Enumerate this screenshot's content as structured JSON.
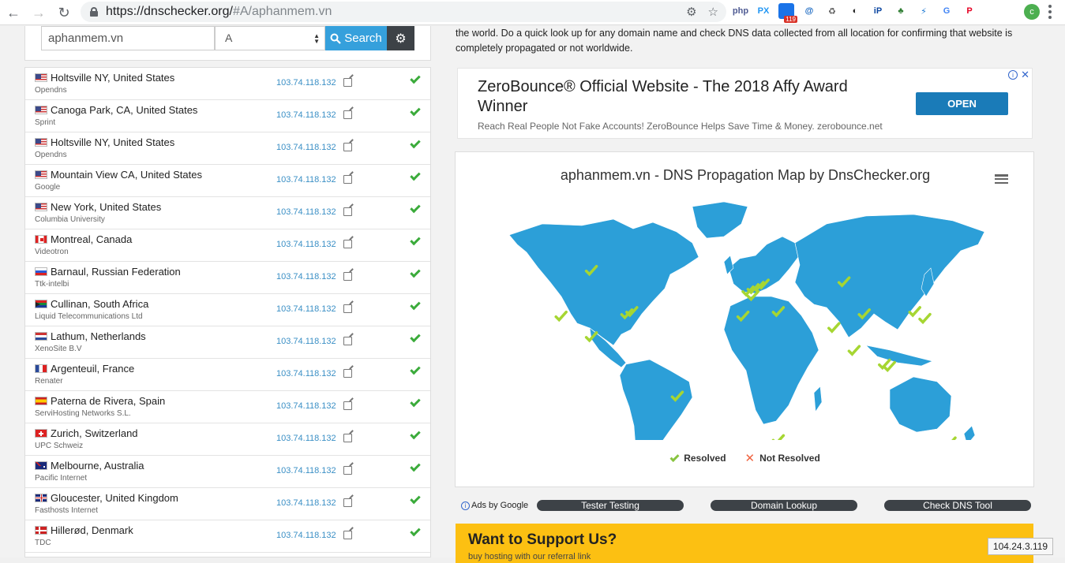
{
  "browser": {
    "url_host": "https://dnschecker.org/",
    "url_path": "#A/aphanmem.vn",
    "extensions": [
      {
        "label": "php",
        "color": "#4f5b93"
      },
      {
        "label": "PX",
        "color": "#2196f3"
      },
      {
        "label": "",
        "color": "#1a73e8",
        "badge": "119"
      },
      {
        "label": "@",
        "color": "#1565c0"
      },
      {
        "label": "♻",
        "color": "#555555"
      },
      {
        "label": "◐",
        "color": "#222222"
      },
      {
        "label": "iP",
        "color": "#0d47a1"
      },
      {
        "label": "♣",
        "color": "#2e7d32"
      },
      {
        "label": "⚡",
        "color": "#1976d2"
      },
      {
        "label": "G",
        "color": "#4285f4"
      },
      {
        "label": "P",
        "color": "#e60023"
      }
    ],
    "profile_initial": "c"
  },
  "search": {
    "domain": "aphanmem.vn",
    "record_type": "A",
    "button_label": "Search"
  },
  "results": [
    {
      "flag": "us",
      "location": "Holtsville NY, United States",
      "isp": "Opendns",
      "ip": "103.74.118.132"
    },
    {
      "flag": "us",
      "location": "Canoga Park, CA, United States",
      "isp": "Sprint",
      "ip": "103.74.118.132"
    },
    {
      "flag": "us",
      "location": "Holtsville NY, United States",
      "isp": "Opendns",
      "ip": "103.74.118.132"
    },
    {
      "flag": "us",
      "location": "Mountain View CA, United States",
      "isp": "Google",
      "ip": "103.74.118.132"
    },
    {
      "flag": "us",
      "location": "New York, United States",
      "isp": "Columbia University",
      "ip": "103.74.118.132"
    },
    {
      "flag": "ca",
      "location": "Montreal, Canada",
      "isp": "Videotron",
      "ip": "103.74.118.132"
    },
    {
      "flag": "ru",
      "location": "Barnaul, Russian Federation",
      "isp": "Ttk-intelbi",
      "ip": "103.74.118.132"
    },
    {
      "flag": "za",
      "location": "Cullinan, South Africa",
      "isp": "Liquid Telecommunications Ltd",
      "ip": "103.74.118.132"
    },
    {
      "flag": "nl",
      "location": "Lathum, Netherlands",
      "isp": "XenoSite B.V",
      "ip": "103.74.118.132"
    },
    {
      "flag": "fr",
      "location": "Argenteuil, France",
      "isp": "Renater",
      "ip": "103.74.118.132"
    },
    {
      "flag": "es",
      "location": "Paterna de Rivera, Spain",
      "isp": "ServiHosting Networks S.L.",
      "ip": "103.74.118.132"
    },
    {
      "flag": "ch",
      "location": "Zurich, Switzerland",
      "isp": "UPC Schweiz",
      "ip": "103.74.118.132"
    },
    {
      "flag": "au",
      "location": "Melbourne, Australia",
      "isp": "Pacific Internet",
      "ip": "103.74.118.132"
    },
    {
      "flag": "gb",
      "location": "Gloucester, United Kingdom",
      "isp": "Fasthosts Internet",
      "ip": "103.74.118.132"
    },
    {
      "flag": "dk",
      "location": "Hillerød, Denmark",
      "isp": "TDC",
      "ip": "103.74.118.132"
    }
  ],
  "intro_text": "the world. Do a quick look up for any domain name and check DNS data collected from all location for confirming that website is completely propagated or not worldwide.",
  "ad": {
    "title": "ZeroBounce® Official Website - The 2018 Affy Award Winner",
    "description": "Reach Real People Not Fake Accounts! ZeroBounce Helps Save Time & Money. zerobounce.net",
    "button": "OPEN"
  },
  "map": {
    "title": "aphanmem.vn - DNS Propagation Map by DnsChecker.org",
    "land_color": "#2c9fd8",
    "marker_color": "#a6d632",
    "legend_resolved": "Resolved",
    "legend_not_resolved": "Not Resolved",
    "markers": [
      [
        0.19,
        0.33
      ],
      [
        0.13,
        0.53
      ],
      [
        0.27,
        0.51
      ],
      [
        0.26,
        0.52
      ],
      [
        0.19,
        0.62
      ],
      [
        0.5,
        0.42
      ],
      [
        0.51,
        0.41
      ],
      [
        0.52,
        0.4
      ],
      [
        0.53,
        0.39
      ],
      [
        0.51,
        0.44
      ],
      [
        0.49,
        0.53
      ],
      [
        0.56,
        0.51
      ],
      [
        0.69,
        0.38
      ],
      [
        0.67,
        0.58
      ],
      [
        0.73,
        0.52
      ],
      [
        0.83,
        0.51
      ],
      [
        0.85,
        0.54
      ],
      [
        0.71,
        0.68
      ],
      [
        0.77,
        0.74
      ],
      [
        0.78,
        0.75
      ],
      [
        0.36,
        0.88
      ],
      [
        0.56,
        1.07
      ],
      [
        0.9,
        1.08
      ]
    ]
  },
  "bottom": {
    "ads_by": "Ads by Google",
    "links": [
      "Tester Testing",
      "Domain Lookup",
      "Check DNS Tool"
    ]
  },
  "support": {
    "title": "Want to Support Us?",
    "subtitle": "buy hosting with our referral link"
  },
  "ip_chip": "104.24.3.119"
}
